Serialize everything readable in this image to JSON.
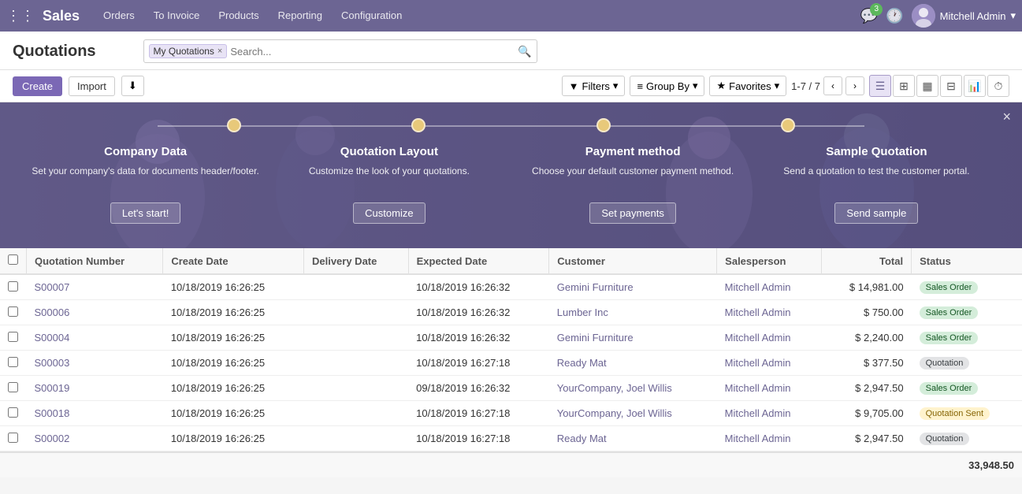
{
  "app": {
    "brand": "Sales",
    "grid_icon": "⊞",
    "nav_items": [
      "Orders",
      "To Invoice",
      "Products",
      "Reporting",
      "Configuration"
    ],
    "user": "Mitchell Admin",
    "msg_count": "3"
  },
  "page": {
    "title": "Quotations",
    "search_tag": "My Quotations",
    "search_placeholder": "Search...",
    "close_icon": "×"
  },
  "toolbar": {
    "create_label": "Create",
    "import_label": "Import",
    "download_label": "⬇",
    "filters_label": "Filters",
    "group_by_label": "Group By",
    "favorites_label": "Favorites",
    "pagination": "1-7 / 7",
    "view_list_icon": "☰",
    "view_kanban_icon": "⊞",
    "view_calendar_icon": "📅",
    "view_table_icon": "⊟",
    "view_chart_icon": "📊",
    "view_clock_icon": "⏱"
  },
  "onboarding": {
    "close_icon": "×",
    "steps": [
      {
        "title": "Company Data",
        "desc": "Set your company's data for documents header/footer.",
        "btn": "Let's start!"
      },
      {
        "title": "Quotation Layout",
        "desc": "Customize the look of your quotations.",
        "btn": "Customize"
      },
      {
        "title": "Payment method",
        "desc": "Choose your default customer payment method.",
        "btn": "Set payments"
      },
      {
        "title": "Sample Quotation",
        "desc": "Send a quotation to test the customer portal.",
        "btn": "Send sample"
      }
    ]
  },
  "table": {
    "columns": [
      "Quotation Number",
      "Create Date",
      "Delivery Date",
      "Expected Date",
      "Customer",
      "Salesperson",
      "Total",
      "Status"
    ],
    "rows": [
      {
        "num": "S00007",
        "create_date": "10/18/2019 16:26:25",
        "delivery_date": "",
        "expected_date": "10/18/2019 16:26:32",
        "customer": "Gemini Furniture",
        "salesperson": "Mitchell Admin",
        "total": "$ 14,981.00",
        "status": "Sales Order",
        "status_class": "status-sales-order"
      },
      {
        "num": "S00006",
        "create_date": "10/18/2019 16:26:25",
        "delivery_date": "",
        "expected_date": "10/18/2019 16:26:32",
        "customer": "Lumber Inc",
        "salesperson": "Mitchell Admin",
        "total": "$ 750.00",
        "status": "Sales Order",
        "status_class": "status-sales-order"
      },
      {
        "num": "S00004",
        "create_date": "10/18/2019 16:26:25",
        "delivery_date": "",
        "expected_date": "10/18/2019 16:26:32",
        "customer": "Gemini Furniture",
        "salesperson": "Mitchell Admin",
        "total": "$ 2,240.00",
        "status": "Sales Order",
        "status_class": "status-sales-order"
      },
      {
        "num": "S00003",
        "create_date": "10/18/2019 16:26:25",
        "delivery_date": "",
        "expected_date": "10/18/2019 16:27:18",
        "customer": "Ready Mat",
        "salesperson": "Mitchell Admin",
        "total": "$ 377.50",
        "status": "Quotation",
        "status_class": "status-quotation"
      },
      {
        "num": "S00019",
        "create_date": "10/18/2019 16:26:25",
        "delivery_date": "",
        "expected_date": "09/18/2019 16:26:32",
        "customer": "YourCompany, Joel Willis",
        "salesperson": "Mitchell Admin",
        "total": "$ 2,947.50",
        "status": "Sales Order",
        "status_class": "status-sales-order"
      },
      {
        "num": "S00018",
        "create_date": "10/18/2019 16:26:25",
        "delivery_date": "",
        "expected_date": "10/18/2019 16:27:18",
        "customer": "YourCompany, Joel Willis",
        "salesperson": "Mitchell Admin",
        "total": "$ 9,705.00",
        "status": "Quotation Sent",
        "status_class": "status-quotation-sent"
      },
      {
        "num": "S00002",
        "create_date": "10/18/2019 16:26:25",
        "delivery_date": "",
        "expected_date": "10/18/2019 16:27:18",
        "customer": "Ready Mat",
        "salesperson": "Mitchell Admin",
        "total": "$ 2,947.50",
        "status": "Quotation",
        "status_class": "status-quotation"
      }
    ],
    "footer_total": "33,948.50"
  }
}
